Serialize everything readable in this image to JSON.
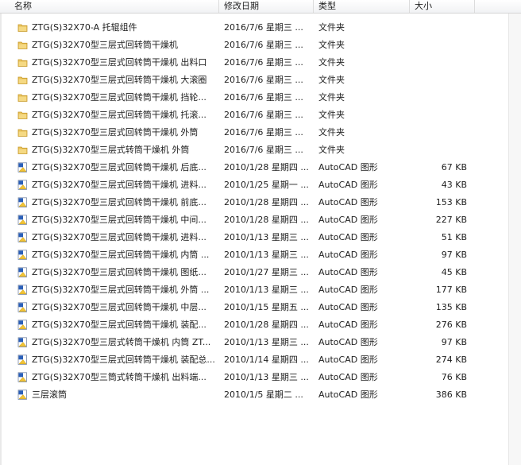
{
  "columns": {
    "name": "名称",
    "date": "修改日期",
    "type": "类型",
    "size": "大小"
  },
  "icons": {
    "folder": "folder-icon",
    "autocad": "autocad-file-icon"
  },
  "colors": {
    "folder_fill": "#e9c35c",
    "folder_dark": "#c89a2b",
    "dwg_blue": "#2a5fb8",
    "dwg_yellow": "#f2c335"
  },
  "rows": [
    {
      "kind": "folder",
      "name": "ZTG(S)32X70-A 托辊组件",
      "date": "2016/7/6 星期三 ...",
      "type": "文件夹",
      "size": ""
    },
    {
      "kind": "folder",
      "name": "ZTG(S)32X70型三层式回转筒干燥机",
      "date": "2016/7/6 星期三 ...",
      "type": "文件夹",
      "size": ""
    },
    {
      "kind": "folder",
      "name": "ZTG(S)32X70型三层式回转筒干燥机 出料口",
      "date": "2016/7/6 星期三 ...",
      "type": "文件夹",
      "size": ""
    },
    {
      "kind": "folder",
      "name": "ZTG(S)32X70型三层式回转筒干燥机 大滚圈",
      "date": "2016/7/6 星期三 ...",
      "type": "文件夹",
      "size": ""
    },
    {
      "kind": "folder",
      "name": "ZTG(S)32X70型三层式回转筒干燥机 挡轮...",
      "date": "2016/7/6 星期三 ...",
      "type": "文件夹",
      "size": ""
    },
    {
      "kind": "folder",
      "name": "ZTG(S)32X70型三层式回转筒干燥机 托滚...",
      "date": "2016/7/6 星期三 ...",
      "type": "文件夹",
      "size": ""
    },
    {
      "kind": "folder",
      "name": "ZTG(S)32X70型三层式回转筒干燥机 外筒",
      "date": "2016/7/6 星期三 ...",
      "type": "文件夹",
      "size": ""
    },
    {
      "kind": "folder",
      "name": "ZTG(S)32X70型三层式转筒干燥机 外筒",
      "date": "2016/7/6 星期三 ...",
      "type": "文件夹",
      "size": ""
    },
    {
      "kind": "dwg",
      "name": "ZTG(S)32X70型三层式回转筒干燥机  后底...",
      "date": "2010/1/28 星期四 ...",
      "type": "AutoCAD 图形",
      "size": "67 KB"
    },
    {
      "kind": "dwg",
      "name": "ZTG(S)32X70型三层式回转筒干燥机  进料...",
      "date": "2010/1/25 星期一 ...",
      "type": "AutoCAD 图形",
      "size": "43 KB"
    },
    {
      "kind": "dwg",
      "name": "ZTG(S)32X70型三层式回转筒干燥机  前底...",
      "date": "2010/1/28 星期四 ...",
      "type": "AutoCAD 图形",
      "size": "153 KB"
    },
    {
      "kind": "dwg",
      "name": "ZTG(S)32X70型三层式回转筒干燥机  中间...",
      "date": "2010/1/28 星期四 ...",
      "type": "AutoCAD 图形",
      "size": "227 KB"
    },
    {
      "kind": "dwg",
      "name": "ZTG(S)32X70型三层式回转筒干燥机 进料...",
      "date": "2010/1/13 星期三 ...",
      "type": "AutoCAD 图形",
      "size": "51 KB"
    },
    {
      "kind": "dwg",
      "name": "ZTG(S)32X70型三层式回转筒干燥机 内筒 ...",
      "date": "2010/1/13 星期三 ...",
      "type": "AutoCAD 图形",
      "size": "97 KB"
    },
    {
      "kind": "dwg",
      "name": "ZTG(S)32X70型三层式回转筒干燥机 图纸...",
      "date": "2010/1/27 星期三 ...",
      "type": "AutoCAD 图形",
      "size": "45 KB"
    },
    {
      "kind": "dwg",
      "name": "ZTG(S)32X70型三层式回转筒干燥机 外筒 ...",
      "date": "2010/1/13 星期三 ...",
      "type": "AutoCAD 图形",
      "size": "177 KB"
    },
    {
      "kind": "dwg",
      "name": "ZTG(S)32X70型三层式回转筒干燥机 中层...",
      "date": "2010/1/15 星期五 ...",
      "type": "AutoCAD 图形",
      "size": "135 KB"
    },
    {
      "kind": "dwg",
      "name": "ZTG(S)32X70型三层式回转筒干燥机 装配...",
      "date": "2010/1/28 星期四 ...",
      "type": "AutoCAD 图形",
      "size": "276 KB"
    },
    {
      "kind": "dwg",
      "name": "ZTG(S)32X70型三层式转筒干燥机 内筒 ZT...",
      "date": "2010/1/13 星期三 ...",
      "type": "AutoCAD 图形",
      "size": "97 KB"
    },
    {
      "kind": "dwg",
      "name": "ZTG(S)32X70型三层式回转筒干燥机 装配总...",
      "date": "2010/1/14 星期四 ...",
      "type": "AutoCAD 图形",
      "size": "274 KB"
    },
    {
      "kind": "dwg",
      "name": "ZTG(S)32X70型三筒式转筒干燥机 出料端...",
      "date": "2010/1/13 星期三 ...",
      "type": "AutoCAD 图形",
      "size": "76 KB"
    },
    {
      "kind": "dwg",
      "name": "三层滚筒",
      "date": "2010/1/5 星期二 ...",
      "type": "AutoCAD 图形",
      "size": "386 KB"
    }
  ]
}
